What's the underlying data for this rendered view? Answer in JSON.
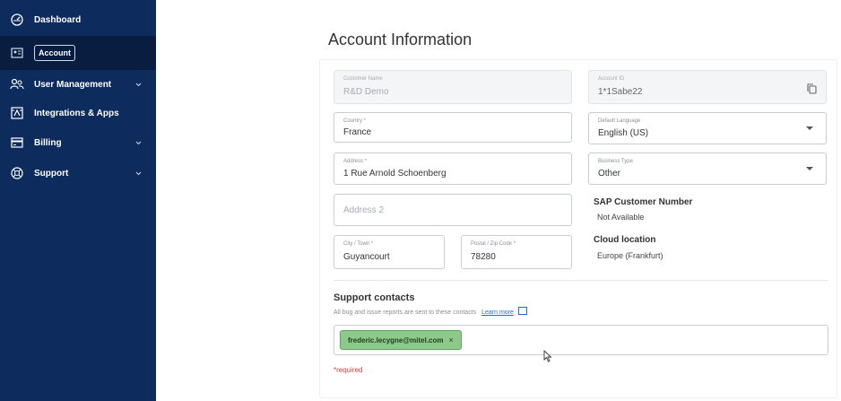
{
  "sidebar": {
    "items": [
      {
        "label": "Dashboard",
        "icon": "dashboard-icon"
      },
      {
        "label": "Account",
        "icon": "account-card-icon"
      },
      {
        "label": "User Management",
        "icon": "users-icon"
      },
      {
        "label": "Integrations & Apps",
        "icon": "integrations-icon"
      },
      {
        "label": "Billing",
        "icon": "billing-icon"
      },
      {
        "label": "Support",
        "icon": "support-icon"
      }
    ]
  },
  "page": {
    "title": "Account Information"
  },
  "form": {
    "customer_name": {
      "label": "Customer Name",
      "value": "R&D Demo"
    },
    "account_id": {
      "label": "Account ID",
      "value": "1*1Sabe22"
    },
    "country": {
      "label": "Country *",
      "value": "France"
    },
    "default_language": {
      "label": "Default Language",
      "value": "English (US)"
    },
    "address": {
      "label": "Address *",
      "value": "1 Rue Arnold Schoenberg"
    },
    "business_type": {
      "label": "Business Type",
      "value": "Other"
    },
    "address2": {
      "placeholder": "Address 2"
    },
    "city": {
      "label": "City / Town *",
      "value": "Guyancourt"
    },
    "postal": {
      "label": "Postal / Zip Code *",
      "value": "78280"
    }
  },
  "info": {
    "sap_title": "SAP Customer Number",
    "sap_value": "Not Available",
    "cloud_title": "Cloud location",
    "cloud_value": "Europe (Frankfurt)"
  },
  "support_contacts": {
    "title": "Support contacts",
    "description": "All bug and issue reports are sent to these contacts",
    "learn_more": "Learn more",
    "chips": [
      "frederic.lecygne@mitel.com"
    ],
    "chip_remove": "×"
  },
  "required_note": "*required",
  "colors": {
    "sidebar": "#0d2b5c",
    "chip": "#8cc98a",
    "required": "#d23b3b",
    "link": "#1a73c9"
  }
}
